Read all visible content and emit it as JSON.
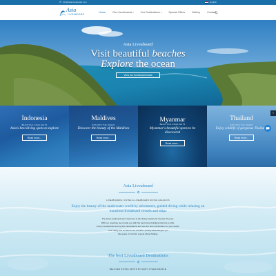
{
  "topbar": {
    "email": "info@asia-liveaboard.com",
    "language": "English",
    "accent": "#1a6fa8"
  },
  "logo": {
    "line1": "Asia",
    "line2": "LIVEABOARD"
  },
  "nav": {
    "items": [
      {
        "label": "Home",
        "dropdown": false,
        "active": true
      },
      {
        "label": "Our Liveaboards",
        "dropdown": true,
        "active": false
      },
      {
        "label": "Our Destinations",
        "dropdown": true,
        "active": false
      },
      {
        "label": "Special Offers",
        "dropdown": false,
        "active": false
      },
      {
        "label": "Gallery",
        "dropdown": false,
        "active": false
      },
      {
        "label": "Contact",
        "dropdown": false,
        "active": false
      }
    ]
  },
  "hero": {
    "subtitle": "Asia Liveaboard",
    "title_part1": "Visit beautiful ",
    "title_italic1": "beaches",
    "title_italic2": "Explore",
    "title_part2": " the ocean",
    "button": "View our liveaboard boats"
  },
  "destinations": [
    {
      "name": "Indonesia",
      "small": "BEAUTIFUL HIGHLIGHTS",
      "tagline": "Asia's best diving spots to explore",
      "button": "Read more..."
    },
    {
      "name": "Maldives",
      "small": "EXPLORE THE OCEAN",
      "tagline": "Discover the beauty of the Maldives",
      "button": "Read more..."
    },
    {
      "name": "Myanmar",
      "small": "BEAUTIFUL HIGHLIGHTS",
      "tagline": "Myanmar's beautiful spots to be discovered",
      "button": "Read more..."
    },
    {
      "name": "Thailand",
      "small": "EXPLORE THE OCEAN",
      "tagline": "Enjoy wildlife of gorgeous Thailand",
      "button": "Read more..."
    }
  ],
  "about": {
    "title": "Asia Liveaboard",
    "caps": "LIVEABOARDS, DIVING & LIVEABOARD DIVING HOLIDAYS",
    "lead": "Enjoy the beauty of the underwater world by adventures, guided diving while relaxing on luxurious liveaboard vessels and ships",
    "body": [
      "The Asia Liveaboard team has been in the diving industry for the last 15 years.",
      "With our expertise we provide you with the best diving holidays Asia has to offer.",
      "Luxury liveaboards and top dive destinations are here the best combination for your needs.",
      "Your safety and comfort is our number 1 priority what will give you",
      "the peace of mind for a great diving holiday."
    ]
  },
  "destinations_section": {
    "title": "The best Liveaboard Destinations",
    "caps": "BELOVED DIVING SPOTS BY MANY OTHER PEOPLE"
  }
}
